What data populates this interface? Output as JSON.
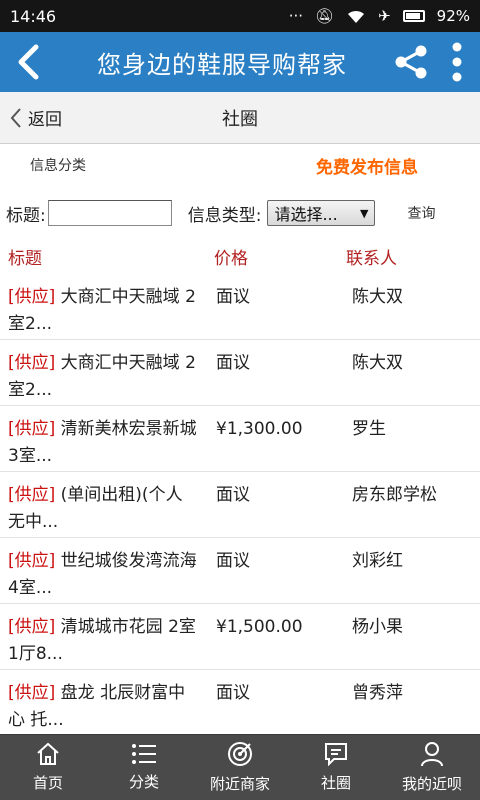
{
  "status": {
    "time": "14:46",
    "battery": "92%"
  },
  "appbar": {
    "title": "您身边的鞋服导购帮家"
  },
  "subnav": {
    "back_label": "返回",
    "page_title": "社圈"
  },
  "info": {
    "category_label": "信息分类",
    "publish_label": "免费发布信息"
  },
  "search": {
    "title_label": "标题:",
    "title_value": "",
    "type_label": "信息类型:",
    "type_selected": "请选择...",
    "query_label": "查询"
  },
  "table": {
    "headers": {
      "title": "标题",
      "price": "价格",
      "contact": "联系人"
    },
    "rows": [
      {
        "tag": "[供应]",
        "title": " 大商汇中天融域 2室2...",
        "price": "面议",
        "contact": "陈大双"
      },
      {
        "tag": "[供应]",
        "title": " 大商汇中天融域 2室2...",
        "price": "面议",
        "contact": "陈大双"
      },
      {
        "tag": "[供应]",
        "title": " 清新美林宏景新城 3室...",
        "price": "¥1,300.00",
        "contact": "罗生"
      },
      {
        "tag": "[供应]",
        "title": " (单间出租)(个人无中...",
        "price": "面议",
        "contact": "房东郎学松"
      },
      {
        "tag": "[供应]",
        "title": " 世纪城俊发湾流海 4室...",
        "price": "面议",
        "contact": "刘彩红"
      },
      {
        "tag": "[供应]",
        "title": " 清城城市花园 2室1厅8...",
        "price": "¥1,500.00",
        "contact": "杨小果"
      },
      {
        "tag": "[供应]",
        "title": " 盘龙 北辰财富中心 托...",
        "price": "面议",
        "contact": "曾秀萍"
      }
    ]
  },
  "tabs": [
    {
      "label": "首页",
      "icon": "home-icon"
    },
    {
      "label": "分类",
      "icon": "list-icon"
    },
    {
      "label": "附近商家",
      "icon": "target-icon"
    },
    {
      "label": "社圈",
      "icon": "message-icon"
    },
    {
      "label": "我的近呗",
      "icon": "person-icon"
    }
  ]
}
